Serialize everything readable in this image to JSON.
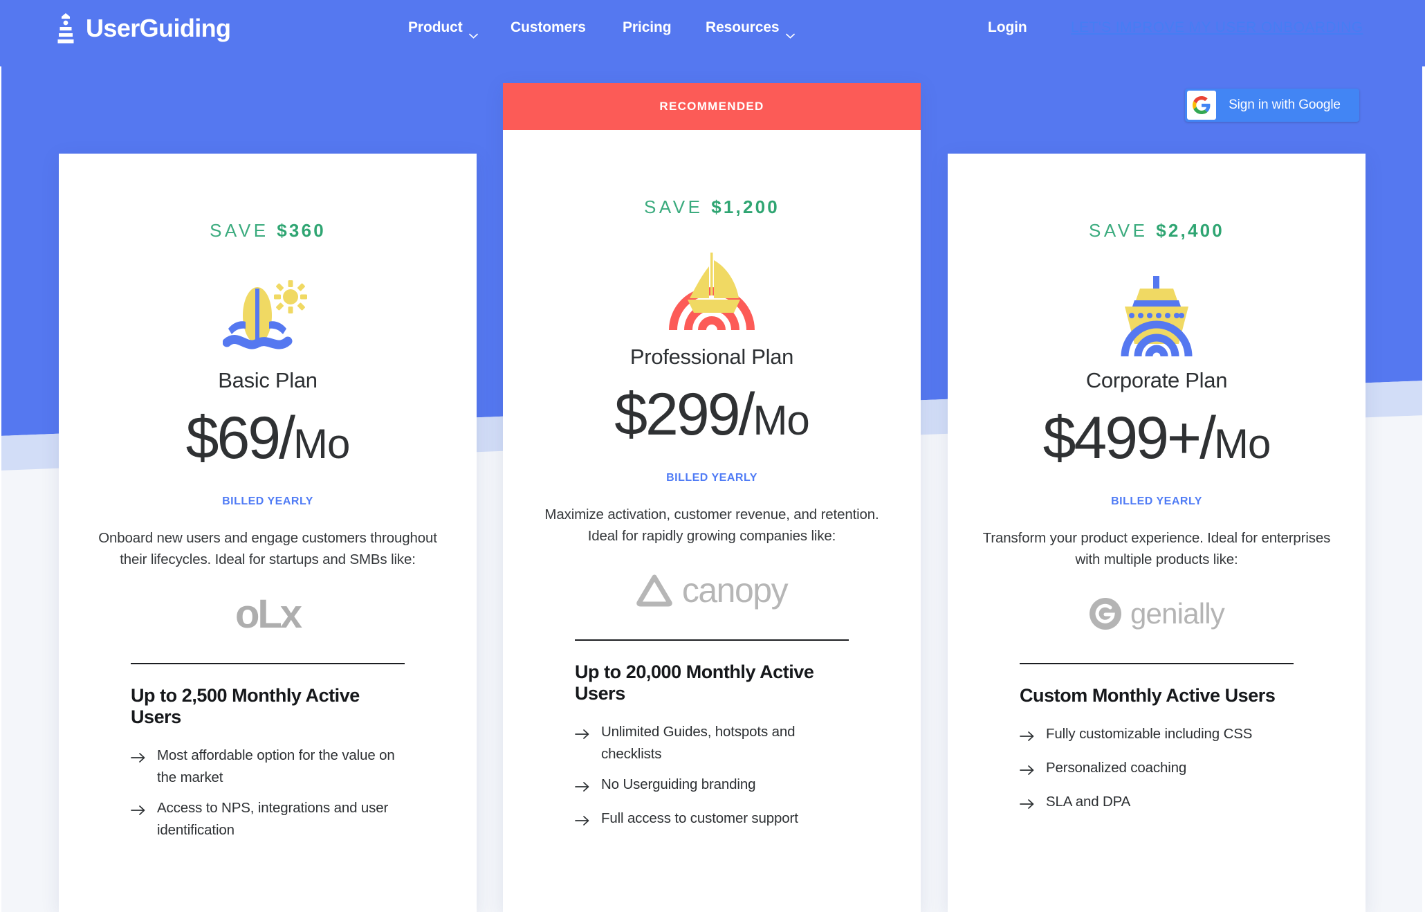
{
  "nav": {
    "brand": "UserGuiding",
    "brand_icon": "lighthouse-logo-icon",
    "links": [
      {
        "label": "Product",
        "has_caret": true
      },
      {
        "label": "Customers",
        "has_caret": false
      },
      {
        "label": "Pricing",
        "has_caret": false
      },
      {
        "label": "Resources",
        "has_caret": true
      }
    ],
    "login_label": "Login",
    "cta_label": "LET'S IMPROVE MY USER ONBOARDING",
    "background_color": "#5578f0"
  },
  "google_signin": {
    "label": "Sign in with Google",
    "icon": "google-g-icon",
    "background_color": "#4285f4"
  },
  "recommended_badge": {
    "label": "RECOMMENDED",
    "color": "#fc5b57"
  },
  "colors": {
    "brand_blue": "#5578f0",
    "accent_red": "#fc5b57",
    "save_green": "#2fa572",
    "billed_blue": "#4f7bf5",
    "icon_yellow": "#f0d963",
    "page_light": "#f4f6fa",
    "stripe_periwinkle": "#d2ddf7"
  },
  "plans": [
    {
      "id": "basic",
      "save_prefix": "SAVE",
      "save_amount": "$360",
      "icon": "surfboard-sun-icon",
      "name": "Basic Plan",
      "price_amount": "$69",
      "price_slash": "/",
      "price_period": "Mo",
      "billed": "BILLED YEARLY",
      "description": "Onboard new users and engage customers throughout their lifecycles. Ideal for startups and SMBs like:",
      "customer_logo": "olx-logo",
      "customer_logo_text": "oLx",
      "mau_title": "Up to 2,500 Monthly Active Users",
      "features": [
        "Most affordable option for the value on the market",
        "Access to NPS, integrations and user identification"
      ]
    },
    {
      "id": "professional",
      "save_prefix": "SAVE",
      "save_amount": "$1,200",
      "icon": "sailboat-sunset-icon",
      "name": "Professional Plan",
      "price_amount": "$299",
      "price_slash": "/",
      "price_period": "Mo",
      "billed": "BILLED YEARLY",
      "description": "Maximize activation, customer revenue, and retention. Ideal for rapidly growing companies like:",
      "customer_logo": "canopy-logo",
      "customer_logo_text": "canopy",
      "mau_title": "Up to 20,000 Monthly Active Users",
      "features": [
        "Unlimited Guides, hotspots and checklists",
        "No Userguiding branding",
        "Full access to customer support"
      ]
    },
    {
      "id": "corporate",
      "save_prefix": "SAVE",
      "save_amount": "$2,400",
      "icon": "cruise-ship-icon",
      "name": "Corporate Plan",
      "price_amount": "$499+",
      "price_slash": "/",
      "price_period": "Mo",
      "billed": "BILLED YEARLY",
      "description": "Transform your product experience. Ideal for enterprises with multiple products like:",
      "customer_logo": "genially-logo",
      "customer_logo_text": "genially",
      "mau_title": "Custom Monthly Active Users",
      "features": [
        "Fully customizable including CSS",
        "Personalized coaching",
        "SLA and DPA"
      ]
    }
  ]
}
